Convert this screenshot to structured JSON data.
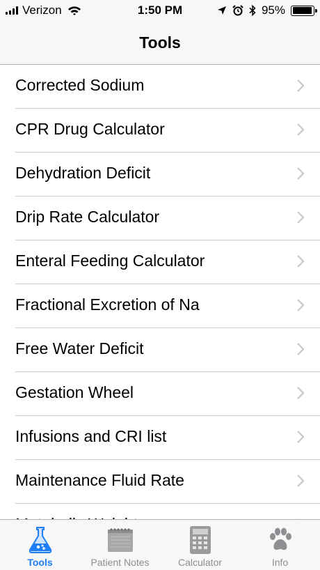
{
  "status_bar": {
    "carrier": "Verizon",
    "time": "1:50 PM",
    "battery_percent": "95%",
    "battery_level": 0.95,
    "icons": [
      "signal-bars-icon",
      "wifi-icon",
      "location-arrow-icon",
      "alarm-clock-icon",
      "bluetooth-icon",
      "battery-icon"
    ]
  },
  "nav": {
    "title": "Tools"
  },
  "list": {
    "items": [
      {
        "label": "Corrected Sodium"
      },
      {
        "label": "CPR Drug Calculator"
      },
      {
        "label": "Dehydration Deficit"
      },
      {
        "label": "Drip Rate Calculator"
      },
      {
        "label": "Enteral Feeding Calculator"
      },
      {
        "label": "Fractional Excretion of Na"
      },
      {
        "label": "Free Water Deficit"
      },
      {
        "label": "Gestation Wheel"
      },
      {
        "label": "Infusions and CRI list"
      },
      {
        "label": "Maintenance Fluid Rate"
      },
      {
        "label": "Metabolic Weight"
      }
    ],
    "chevron_icon": "chevron-right-icon"
  },
  "tab_bar": {
    "tabs": [
      {
        "label": "Tools",
        "icon": "flask-icon",
        "active": true
      },
      {
        "label": "Patient Notes",
        "icon": "notepad-icon",
        "active": false
      },
      {
        "label": "Calculator",
        "icon": "calculator-icon",
        "active": false
      },
      {
        "label": "Info",
        "icon": "paw-print-icon",
        "active": false
      }
    ]
  },
  "colors": {
    "accent": "#1f7ef6",
    "bar_background": "#f7f7f7",
    "inactive_tab": "#8e8e93",
    "separator": "#cdcdd2"
  }
}
